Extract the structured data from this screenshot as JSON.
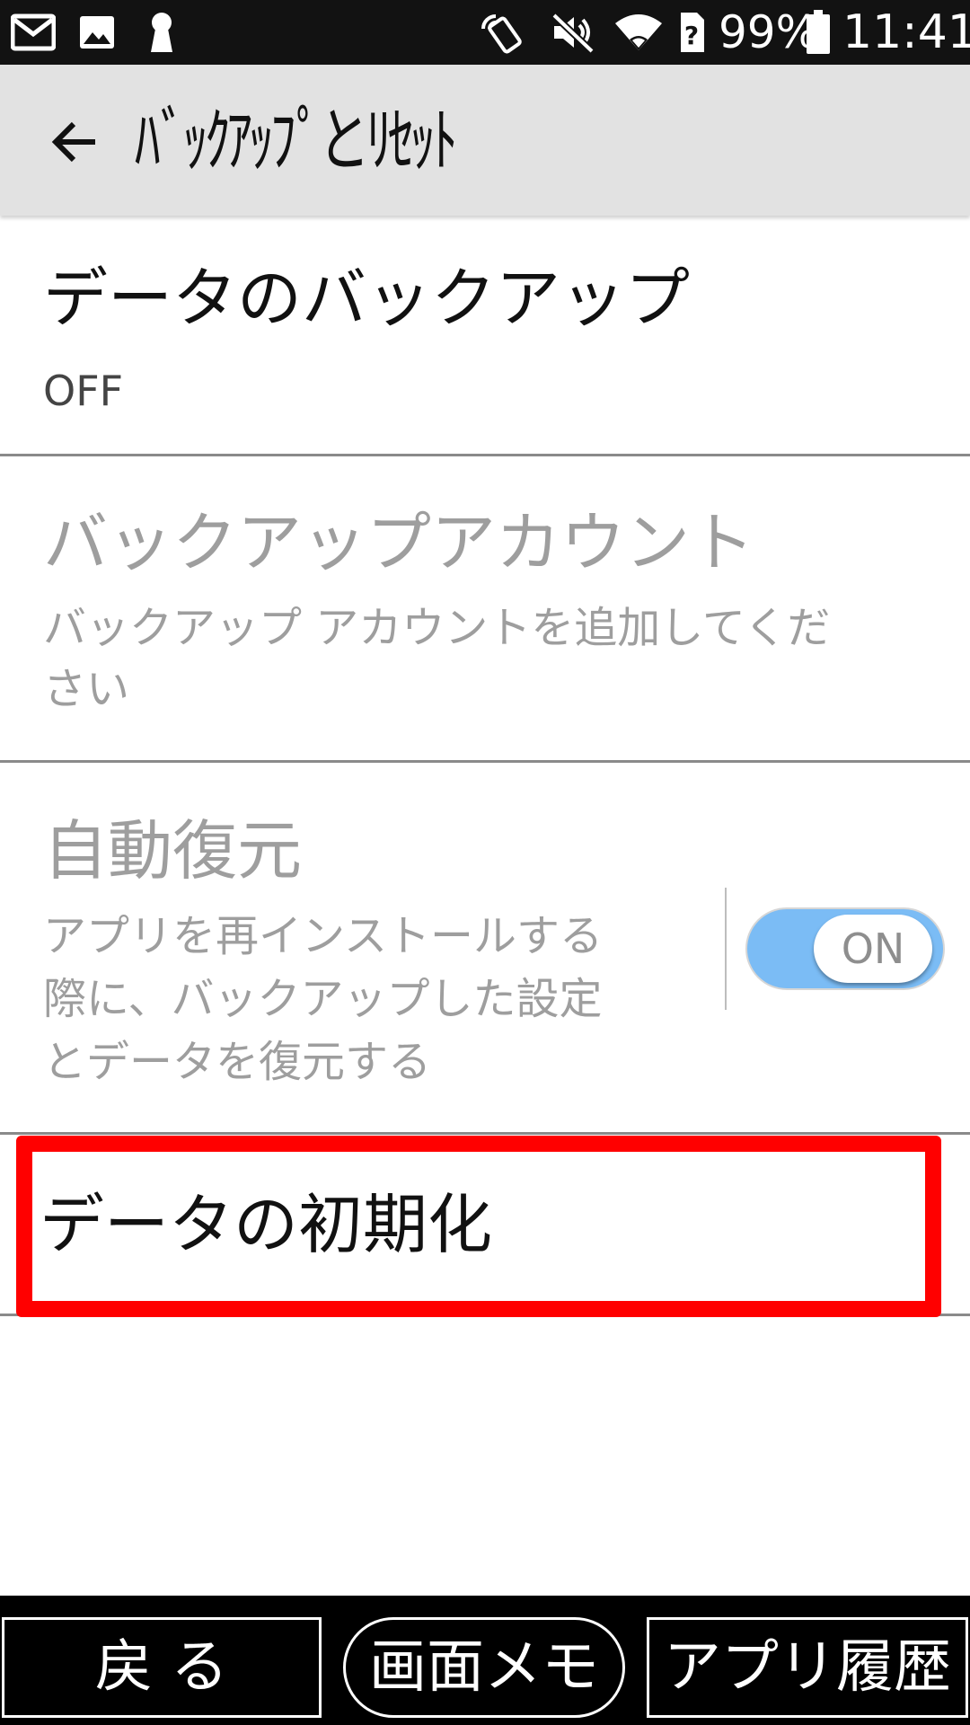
{
  "status_bar": {
    "icons": [
      "gmail-icon",
      "image-icon",
      "keyhole-icon",
      "nfc-icon",
      "mute-icon",
      "wifi-icon",
      "sim-unknown-icon",
      "battery-icon"
    ],
    "battery_percent": "99%",
    "time": "11:41"
  },
  "app_bar": {
    "back_icon": "arrow-left-icon",
    "title": "ﾊﾞｯｸｱｯﾌﾟとﾘｾｯﾄ"
  },
  "items": [
    {
      "title": "データのバックアップ",
      "summary": "OFF"
    },
    {
      "title": "バックアップアカウント",
      "summary_line1": "バックアップ アカウントを追加してくだ",
      "summary_line2": "さい"
    },
    {
      "title": "自動復元",
      "summary_line1": "アプリを再インストールする",
      "summary_line2": "際に、バックアップした設定",
      "summary_line3": "とデータを復元する",
      "toggle_label": "ON"
    },
    {
      "title": "データの初期化"
    }
  ],
  "colors": {
    "highlight": "#ff0000",
    "toggle_on": "#7bbcf5",
    "app_bar_bg": "#e2e2e2"
  },
  "bottom_bar": {
    "back": "戻 る",
    "screen_memo": "画面メモ",
    "app_history": "アプリ履歴"
  }
}
